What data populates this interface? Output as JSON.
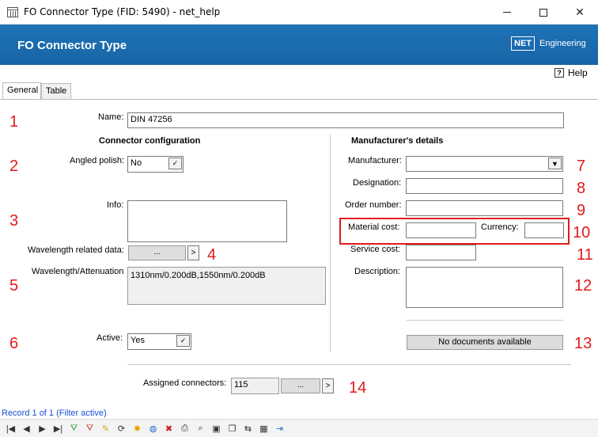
{
  "window": {
    "title": "FO Connector Type (FID: 5490) - net_help",
    "minimize": "",
    "maximize": "",
    "close": "✕"
  },
  "header": {
    "title": "FO Connector Type",
    "logo_box": "NET",
    "logo_text": "Engineering",
    "background_color": "#1c6cb0"
  },
  "help": {
    "label": "Help",
    "icon": "?"
  },
  "tabs": [
    {
      "label": "General",
      "active": true
    },
    {
      "label": "Table",
      "active": false
    }
  ],
  "form": {
    "name_label": "Name:",
    "name_value": "DIN 47256",
    "connector_config_heading": "Connector configuration",
    "angled_polish_label": "Angled polish:",
    "angled_polish_value": "No",
    "info_label": "Info:",
    "info_value": "",
    "wavelength_related_label": "Wavelength related data:",
    "wavelength_related_btn": "...",
    "wavelength_related_arrow": ">",
    "wavelength_att_label": "Wavelength/Attenuation",
    "wavelength_att_value": "1310nm/0.200dB,1550nm/0.200dB",
    "active_label": "Active:",
    "active_value": "Yes",
    "manufacturer_heading": "Manufacturer's details",
    "manufacturer_label": "Manufacturer:",
    "manufacturer_value": "",
    "designation_label": "Designation:",
    "designation_value": "",
    "order_number_label": "Order number:",
    "order_number_value": "",
    "material_cost_label": "Material cost:",
    "material_cost_value": "",
    "currency_label": "Currency:",
    "currency_value": "",
    "service_cost_label": "Service cost:",
    "service_cost_value": "",
    "description_label": "Description:",
    "description_value": "",
    "documents_btn": "No documents available",
    "assigned_connectors_label": "Assigned connectors:",
    "assigned_connectors_value": "115",
    "assigned_btn": "...",
    "assigned_arrow": ">",
    "check_glyph": "✓",
    "combo_glyph": "▼"
  },
  "annotations": [
    "1",
    "2",
    "3",
    "4",
    "5",
    "6",
    "7",
    "8",
    "9",
    "10",
    "11",
    "12",
    "13",
    "14"
  ],
  "annotation_color": "#e01b1b",
  "status": {
    "text": "Record 1 of 1 (Filter active)",
    "color": "#1a4fd8"
  },
  "toolbar": {
    "icons": [
      {
        "name": "first-record-icon",
        "glyph": "|◀"
      },
      {
        "name": "prev-record-icon",
        "glyph": "◀"
      },
      {
        "name": "next-record-icon",
        "glyph": "▶"
      },
      {
        "name": "last-record-icon",
        "glyph": "▶|"
      },
      {
        "name": "add-filter-icon",
        "glyph": "⛛"
      },
      {
        "name": "remove-filter-icon",
        "glyph": "⛛"
      },
      {
        "name": "edit-icon",
        "glyph": "✎"
      },
      {
        "name": "refresh-icon",
        "glyph": "⟳"
      },
      {
        "name": "new-icon",
        "glyph": "✸"
      },
      {
        "name": "web-icon",
        "glyph": "◍"
      },
      {
        "name": "delete-icon",
        "glyph": "✖"
      },
      {
        "name": "print-icon",
        "glyph": "⎙"
      },
      {
        "name": "search-icon",
        "glyph": "⌕"
      },
      {
        "name": "select-icon",
        "glyph": "▣"
      },
      {
        "name": "copy-icon",
        "glyph": "❐"
      },
      {
        "name": "link-icon",
        "glyph": "⇆"
      },
      {
        "name": "table-icon",
        "glyph": "▦"
      },
      {
        "name": "exit-icon",
        "glyph": "⇥"
      }
    ]
  }
}
